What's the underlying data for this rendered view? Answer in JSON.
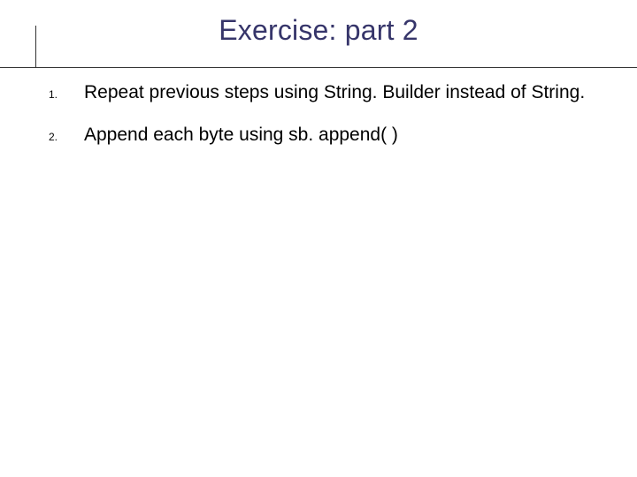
{
  "title": "Exercise: part 2",
  "items": [
    {
      "num": "1.",
      "text": "Repeat previous steps using String. Builder instead of String."
    },
    {
      "num": "2.",
      "text": "Append each byte using sb. append( )"
    }
  ]
}
